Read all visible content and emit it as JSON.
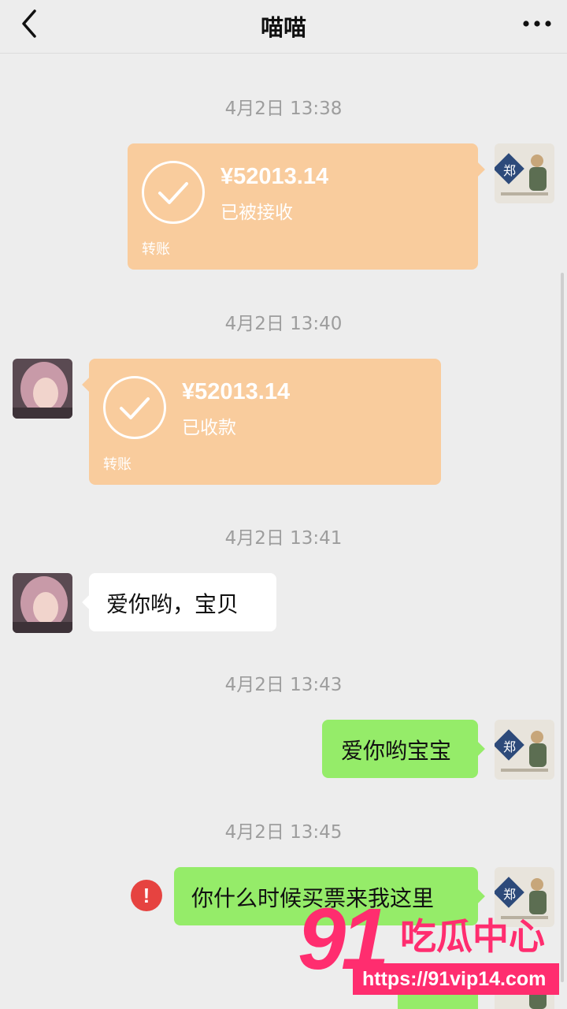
{
  "header": {
    "title": "喵喵"
  },
  "messages": {
    "m1": {
      "time": "4月2日 13:38",
      "amount": "¥52013.14",
      "status": "已被接收",
      "label": "转账"
    },
    "m2": {
      "time": "4月2日 13:40",
      "amount": "¥52013.14",
      "status": "已收款",
      "label": "转账"
    },
    "m3": {
      "time": "4月2日 13:41",
      "text": "爱你哟，宝贝"
    },
    "m4": {
      "time": "4月2日 13:43",
      "text": "爱你哟宝宝"
    },
    "m5": {
      "time": "4月2日 13:45",
      "text": "你什么时候买票来我这里"
    }
  },
  "error_glyph": "!",
  "watermark": {
    "number": "91",
    "name": "吃瓜中心",
    "url": "https://91vip14.com"
  },
  "colors": {
    "transfer_bubble": "#f9cc9d",
    "sent_bubble": "#95ec69",
    "received_bubble": "#ffffff",
    "error": "#e64340",
    "watermark": "#ff2d6f"
  }
}
